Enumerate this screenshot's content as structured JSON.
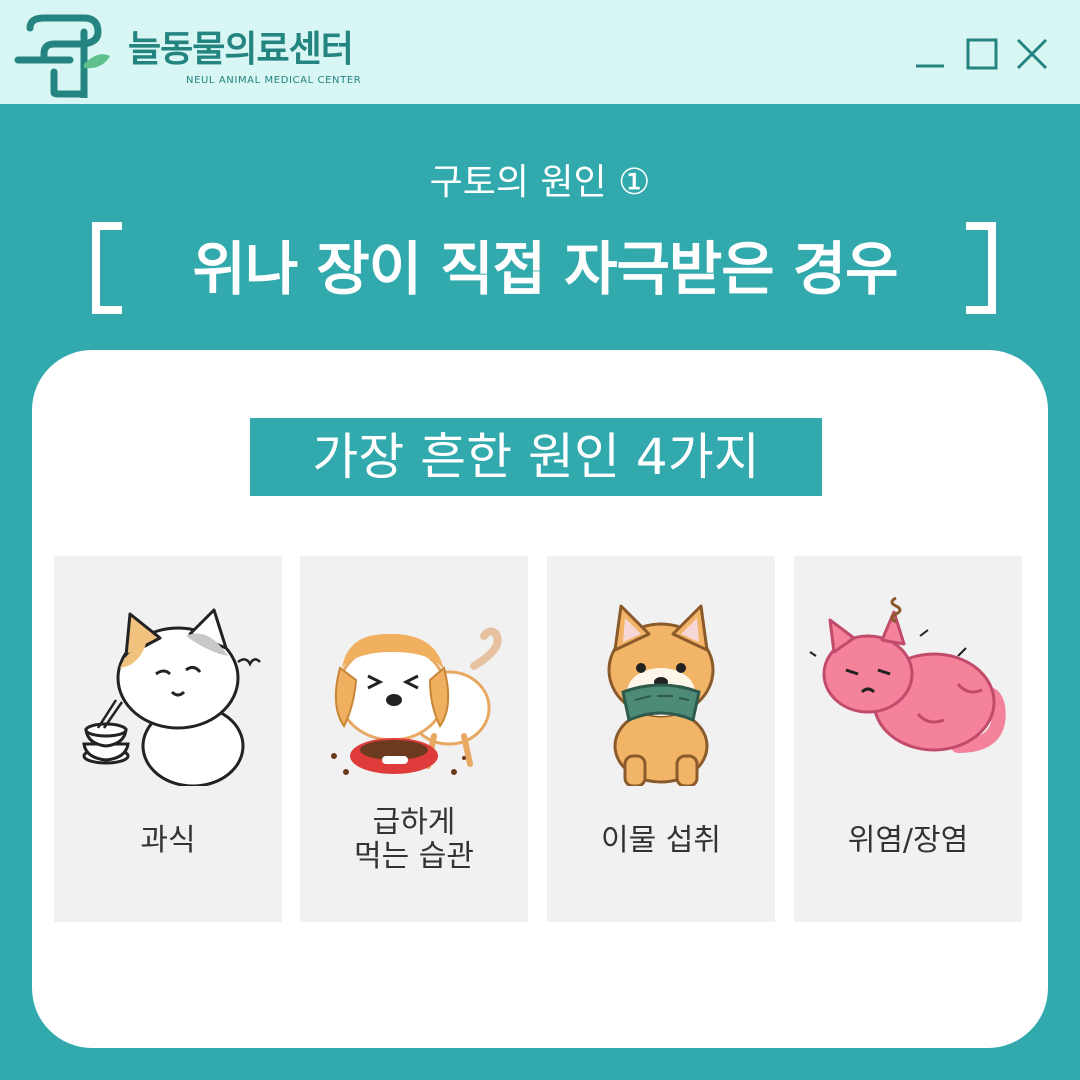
{
  "header": {
    "brand_korean": "늘동물의료센터",
    "brand_english": "NEUL ANIMAL MEDICAL CENTER",
    "logo_icon": "neul-logo-icon",
    "window_controls": [
      "minimize-icon",
      "maximize-icon",
      "close-icon"
    ]
  },
  "subtitle": "구토의 원인 ①",
  "title": "위나 장이 직접 자극받은 경우",
  "badge": "가장 흔한 원인 4가지",
  "causes": [
    {
      "lines": [
        "과식"
      ],
      "icon": "overeating-cat-icon"
    },
    {
      "lines": [
        "급하게",
        "먹는 습관"
      ],
      "icon": "fast-eating-dog-icon"
    },
    {
      "lines": [
        "이물 섭취"
      ],
      "icon": "foreign-object-dog-icon"
    },
    {
      "lines": [
        "위염/장염"
      ],
      "icon": "sick-cat-icon"
    }
  ],
  "colors": {
    "teal": "#31a9ad",
    "header_bg": "#d8f6f3",
    "brand": "#24847f",
    "tile_bg": "#f1f1f1"
  }
}
